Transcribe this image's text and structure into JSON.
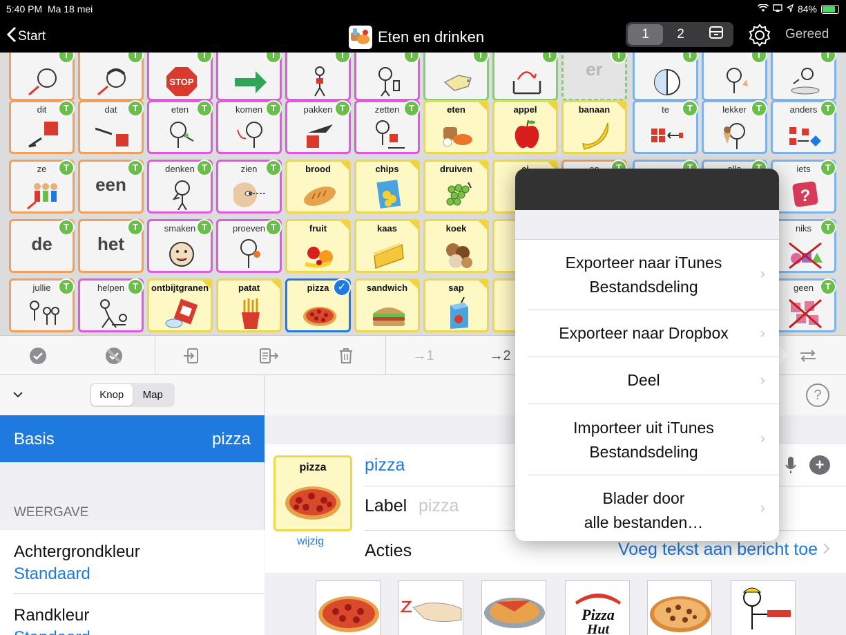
{
  "status": {
    "time": "5:40 PM",
    "date": "Ma 18 mei",
    "battery": "84%"
  },
  "nav": {
    "back_label": "Start",
    "title": "Eten en drinken",
    "page1": "1",
    "page2": "2",
    "done_label": "Gereed"
  },
  "grid": {
    "row0": [
      "",
      "",
      "",
      "",
      "",
      "",
      "",
      "",
      "er",
      "",
      "",
      ""
    ],
    "row1": [
      "dit",
      "dat",
      "eten",
      "komen",
      "pakken",
      "zetten",
      "eten",
      "appel",
      "banaan",
      "te",
      "lekker",
      "anders"
    ],
    "row2": [
      "ze",
      "een",
      "denken",
      "zien",
      "brood",
      "chips",
      "druiven",
      "ei",
      "en",
      "",
      "alle",
      "iets"
    ],
    "row3": [
      "de",
      "het",
      "smaken",
      "proeven",
      "fruit",
      "kaas",
      "koek",
      "",
      "",
      "",
      "",
      "niks"
    ],
    "row4": [
      "jullie",
      "helpen",
      "ontbijtgranen",
      "patat",
      "pizza",
      "sandwich",
      "sap",
      "s",
      "",
      "",
      "",
      "geen"
    ]
  },
  "toolbar": {
    "page1": "→1",
    "page2": "→2"
  },
  "left": {
    "tab_button": "Knop",
    "tab_folder": "Map",
    "selected_left": "Basis",
    "selected_right": "pizza",
    "section": "WEERGAVE",
    "bg_title": "Achtergrondkleur",
    "bg_value": "Standaard",
    "border_title": "Randkleur",
    "border_value": "Standaard"
  },
  "right": {
    "thumb_label": "pizza",
    "edit_label": "wijzig",
    "text_value": "pizza",
    "label_title": "Label",
    "label_placeholder": "pizza",
    "actions_title": "Acties",
    "actions_value": "Voeg tekst aan bericht toe",
    "help": "?"
  },
  "popover": {
    "items": [
      {
        "line1": "Exporteer naar iTunes",
        "line2": "Bestandsdeling"
      },
      {
        "line1": "Exporteer naar Dropbox",
        "line2": ""
      },
      {
        "line1": "Deel",
        "line2": ""
      },
      {
        "line1": "Importeer uit iTunes",
        "line2": "Bestandsdeling"
      },
      {
        "line1": "Blader door",
        "line2": "alle bestanden…"
      }
    ]
  },
  "colors": {
    "accent": "#1f7ae0",
    "tbadge": "#6abf4b",
    "nav_bg": "#000000",
    "food_bg": "#fdf8c4"
  }
}
